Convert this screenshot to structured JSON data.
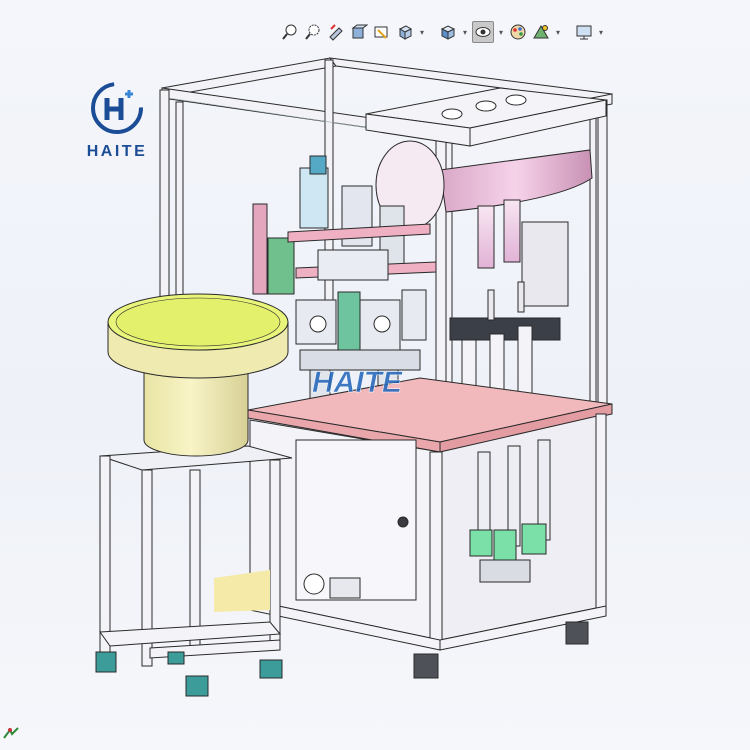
{
  "app": {
    "view": "isometric shaded model view",
    "background_color": "#eef1f8"
  },
  "toolbar": {
    "items": [
      {
        "icon": "zoom-to-fit-icon",
        "has_dropdown": false
      },
      {
        "icon": "zoom-to-area-icon",
        "has_dropdown": false
      },
      {
        "icon": "previous-view-icon",
        "has_dropdown": false
      },
      {
        "icon": "section-view-icon",
        "has_dropdown": false
      },
      {
        "icon": "dynamic-annotation-icon",
        "has_dropdown": false
      },
      {
        "icon": "view-orientation-icon",
        "has_dropdown": true
      },
      {
        "icon": "display-style-icon",
        "has_dropdown": true
      },
      {
        "icon": "hide-show-items-icon",
        "has_dropdown": true,
        "active": true
      },
      {
        "icon": "edit-appearance-icon",
        "has_dropdown": false
      },
      {
        "icon": "apply-scene-icon",
        "has_dropdown": true
      },
      {
        "icon": "view-settings-icon",
        "has_dropdown": true
      }
    ]
  },
  "logo": {
    "text": "HAITE",
    "color": "#1b4d96"
  },
  "model": {
    "watermark": "HAITE",
    "colors": {
      "frame": "#f2f2f7",
      "frame_edge": "#2a2a2a",
      "table_top": "#f2b9bd",
      "bowl_top": "#e8f57a",
      "bowl_body": "#f4f0b8",
      "tube": "#efb8e0",
      "cylinder_green": "#7be0a8",
      "watermark": "#1e63b8"
    }
  }
}
